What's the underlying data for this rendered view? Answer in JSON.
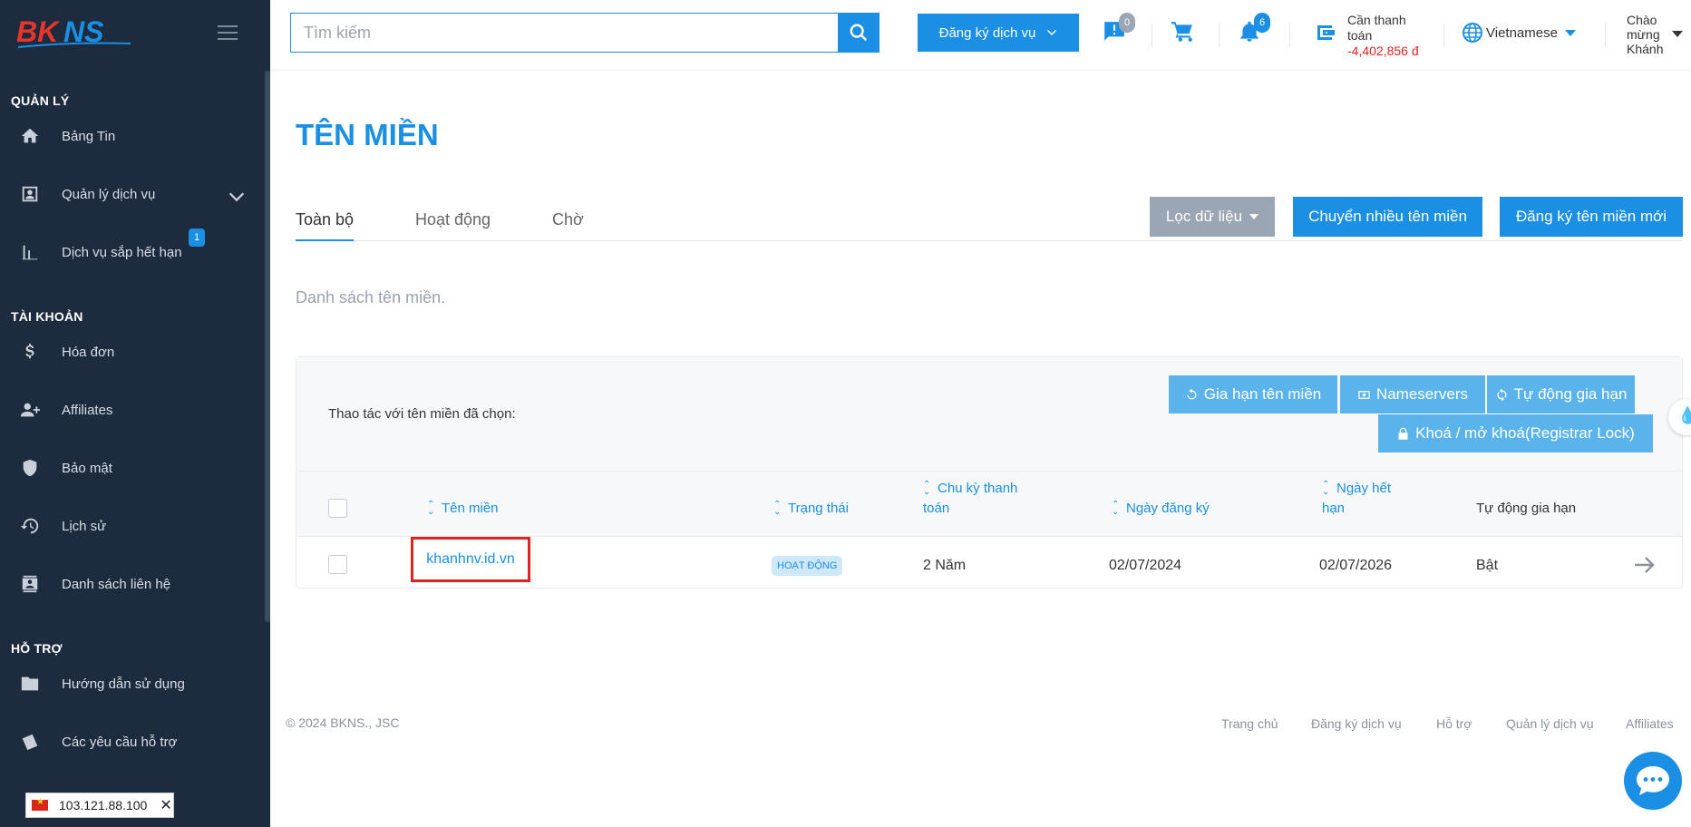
{
  "brand": {
    "logo_text": "BKNS",
    "accent": "#1a8fe3",
    "sidebar_bg": "#1d2b3e"
  },
  "sidebar": {
    "sections": [
      {
        "label": "QUẢN LÝ"
      },
      {
        "label": "TÀI KHOẢN"
      },
      {
        "label": "HỖ TRỢ"
      }
    ],
    "items": [
      {
        "label": "Bảng Tin",
        "icon": "home-icon"
      },
      {
        "label": "Quản lý dịch vụ",
        "icon": "user-box-icon"
      },
      {
        "label": "Dịch vụ sắp hết hạn",
        "icon": "bar-chart-icon",
        "badge": "1"
      },
      {
        "label": "Hóa đơn",
        "icon": "dollar-icon"
      },
      {
        "label": "Affiliates",
        "icon": "user-add-icon"
      },
      {
        "label": "Bảo mật",
        "icon": "shield-icon"
      },
      {
        "label": "Lịch sử",
        "icon": "history-icon"
      },
      {
        "label": "Danh sách liên hệ",
        "icon": "contact-card-icon"
      },
      {
        "label": "Hướng dẫn sử dụng",
        "icon": "folder-icon"
      },
      {
        "label": "Các yêu cầu hỗ trợ",
        "icon": "ticket-icon"
      }
    ],
    "ip": "103.121.88.100"
  },
  "topbar": {
    "search_placeholder": "Tìm kiếm",
    "register_service": "Đăng ký dịch vụ",
    "messages_count": "0",
    "notifications_count": "6",
    "wallet_label": "Cần thanh toán",
    "wallet_line1": "Cần thanh",
    "wallet_line2": "toán",
    "wallet_amount": "-4,402,856 đ",
    "language": "Vietnamese",
    "welcome_line1": "Chào",
    "welcome_line2": "mừng",
    "welcome_line3": "Khánh"
  },
  "main": {
    "title": "TÊN MIỀN",
    "tabs": [
      {
        "label": "Toàn bộ",
        "active": true
      },
      {
        "label": "Hoạt động",
        "active": false
      },
      {
        "label": "Chờ",
        "active": false
      }
    ],
    "filter_label": "Lọc dữ liệu",
    "transfer_label": "Chuyển nhiều tên miền",
    "register_domain_label": "Đăng ký tên miền mới",
    "list_desc": "Danh sách tên miền.",
    "bulk_label": "Thao tác với tên miền đã chọn:",
    "actions": {
      "renew": "Gia hạn tên miền",
      "nameservers": "Nameservers",
      "auto_renew": "Tự động gia hạn",
      "lock": "Khoá / mở khoá(Registrar Lock)"
    },
    "columns": {
      "domain": "Tên miền",
      "status": "Trạng thái",
      "cycle_1": "Chu kỳ thanh",
      "cycle_2": "toán",
      "reg_date": "Ngày đăng ký",
      "exp_1": "Ngày hết",
      "exp_2": "hạn",
      "auto_renew": "Tự động gia hạn"
    },
    "rows": [
      {
        "domain": "khanhnv.id.vn",
        "status": "HOẠT ĐỘNG",
        "cycle": "2 Năm",
        "reg_date": "02/07/2024",
        "exp_date": "02/07/2026",
        "auto_renew": "Bật"
      }
    ]
  },
  "footer": {
    "copyright": "© 2024 BKNS., JSC",
    "links": [
      "Trang chủ",
      "Đăng ký dịch vụ",
      "Hỗ trợ",
      "Quản lý dịch vụ",
      "Affiliates"
    ]
  }
}
